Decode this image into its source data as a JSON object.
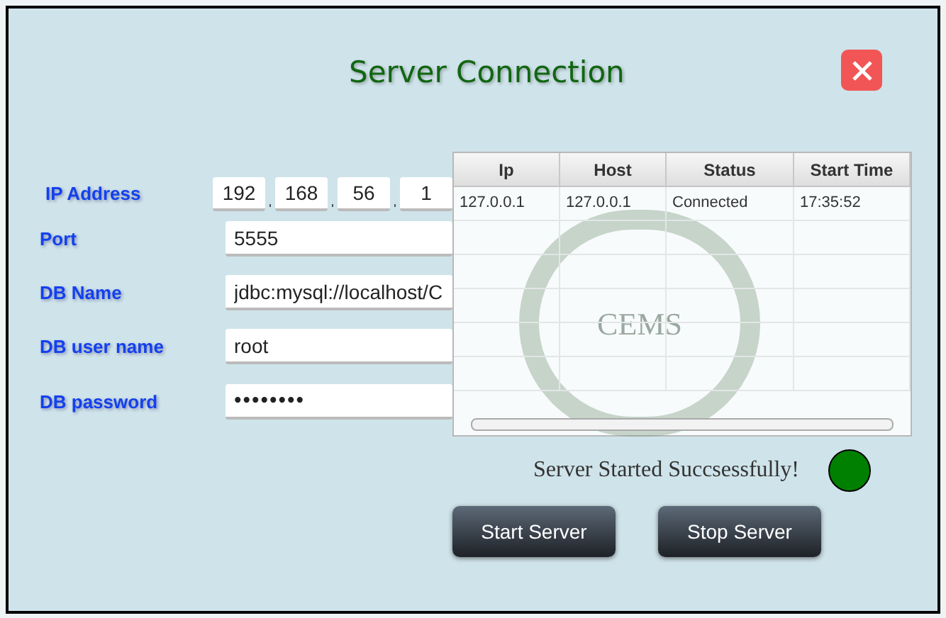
{
  "window": {
    "title": "Server Connection"
  },
  "form": {
    "ip_address": {
      "label": "IP Address",
      "octets": [
        "192",
        "168",
        "56",
        "1"
      ]
    },
    "fields": [
      {
        "label": "Port",
        "value": "5555",
        "kind": "text"
      },
      {
        "label": "DB Name",
        "value": "jdbc:mysql://localhost/C",
        "kind": "text"
      },
      {
        "label": "DB user name",
        "value": "root",
        "kind": "text"
      },
      {
        "label": "DB password",
        "value": "••••••••",
        "kind": "password"
      }
    ]
  },
  "table": {
    "columns": [
      "Ip",
      "Host",
      "Status",
      "Start Time"
    ],
    "rows": [
      [
        "127.0.0.1",
        "127.0.0.1",
        "Connected",
        "17:35:52"
      ]
    ]
  },
  "logo": {
    "text": "CEMS"
  },
  "status": {
    "message": "Server Started Succsessfully!",
    "color": "#008000"
  },
  "buttons": [
    "Start Server",
    "Stop Server"
  ]
}
